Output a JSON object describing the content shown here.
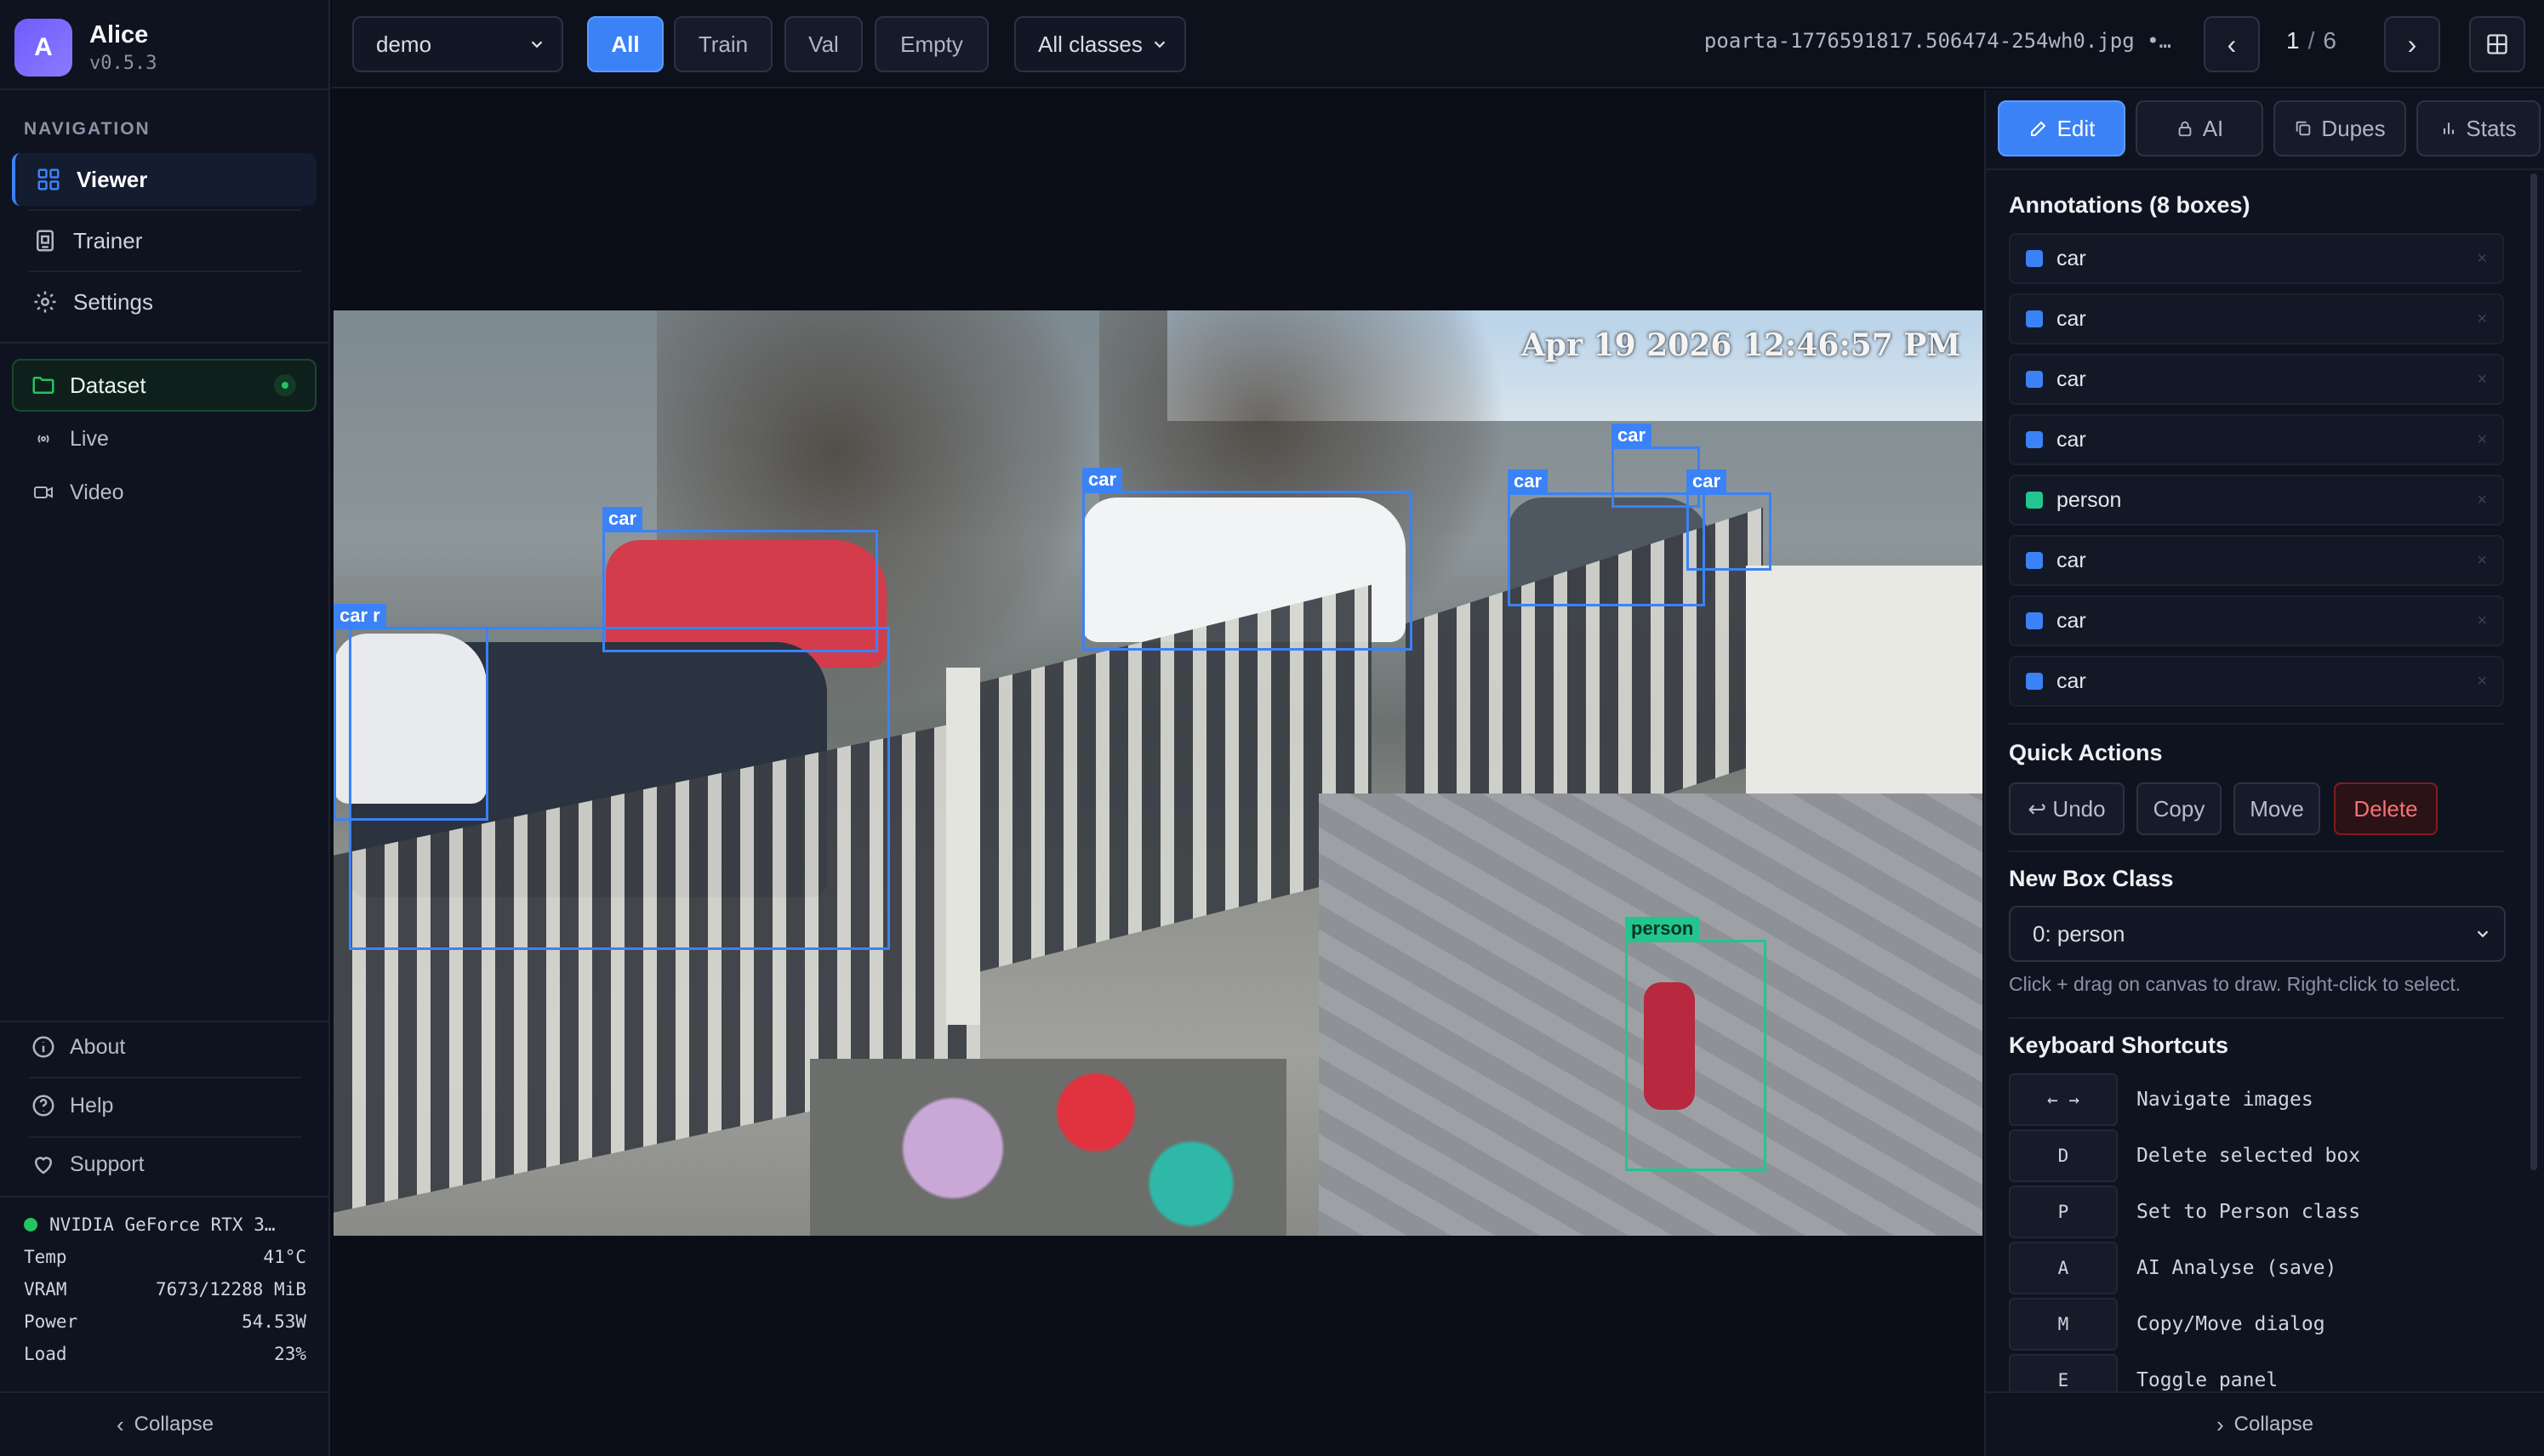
{
  "app": {
    "name": "Alice",
    "version": "v0.5.3",
    "avatar_letter": "A"
  },
  "sidebar": {
    "nav_heading": "NAVIGATION",
    "items": [
      {
        "label": "Viewer",
        "icon": "grid-icon",
        "active": true
      },
      {
        "label": "Trainer",
        "icon": "cpu-icon"
      },
      {
        "label": "Settings",
        "icon": "gear-icon"
      }
    ],
    "dataset": {
      "label": "Dataset",
      "icon": "folder-icon",
      "status": "online"
    },
    "sub_items": [
      {
        "label": "Live",
        "icon": "broadcast-icon"
      },
      {
        "label": "Video",
        "icon": "video-camera-icon"
      }
    ],
    "footer_items": [
      {
        "label": "About",
        "icon": "info-icon"
      },
      {
        "label": "Help",
        "icon": "help-circle-icon"
      },
      {
        "label": "Support",
        "icon": "heart-icon"
      }
    ],
    "gpu": {
      "name": "NVIDIA GeForce RTX 3…",
      "rows": [
        {
          "k": "Temp",
          "v": "41°C"
        },
        {
          "k": "VRAM",
          "v": "7673/12288 MiB"
        },
        {
          "k": "Power",
          "v": "54.53W"
        },
        {
          "k": "Load",
          "v": "23%"
        }
      ]
    },
    "collapse_label": "Collapse"
  },
  "topbar": {
    "dataset_select": "demo",
    "filters": [
      {
        "label": "All",
        "active": true
      },
      {
        "label": "Train"
      },
      {
        "label": "Val"
      },
      {
        "label": "Empty"
      }
    ],
    "class_select": "All classes",
    "filename": "poarta-1776591817.506474-254wh0.jpg •…",
    "page_current": "1",
    "page_sep": "/",
    "page_total": "6",
    "prev_icon": "chevron-left-icon",
    "next_icon": "chevron-right-icon",
    "layout_icon": "layout-grid-icon"
  },
  "image": {
    "camera_timestamp": "Apr 19 2026  12:46:57 PM",
    "boxes": [
      {
        "label": "car",
        "cls": "car"
      },
      {
        "label": "car r",
        "cls": "car"
      },
      {
        "label": "car",
        "cls": "car"
      },
      {
        "label": "car",
        "cls": "car"
      },
      {
        "label": "car",
        "cls": "car"
      },
      {
        "label": "car",
        "cls": "car"
      },
      {
        "label": "person",
        "cls": "person"
      }
    ]
  },
  "panel": {
    "tabs": [
      {
        "label": "Edit",
        "icon": "edit-icon",
        "active": true
      },
      {
        "label": "AI",
        "icon": "lock-icon"
      },
      {
        "label": "Dupes",
        "icon": "copy-icon"
      },
      {
        "label": "Stats",
        "icon": "bar-chart-icon"
      }
    ],
    "annotations_title": "Annotations (8 boxes)",
    "annotations": [
      {
        "label": "car",
        "color": "#3b82f6"
      },
      {
        "label": "car",
        "color": "#3b82f6"
      },
      {
        "label": "car",
        "color": "#3b82f6"
      },
      {
        "label": "car",
        "color": "#3b82f6"
      },
      {
        "label": "person",
        "color": "#22c58e"
      },
      {
        "label": "car",
        "color": "#3b82f6"
      },
      {
        "label": "car",
        "color": "#3b82f6"
      },
      {
        "label": "car",
        "color": "#3b82f6"
      }
    ],
    "delete_glyph": "×",
    "quick_actions_title": "Quick Actions",
    "quick_actions": {
      "undo": "↩ Undo",
      "copy": "Copy",
      "move": "Move",
      "delete": "Delete"
    },
    "new_box_title": "New Box Class",
    "new_box_value": "0: person",
    "hint": "Click + drag on canvas to draw. Right-click to select.",
    "shortcuts_title": "Keyboard Shortcuts",
    "shortcuts": [
      {
        "key": "← →",
        "desc": "Navigate images"
      },
      {
        "key": "D",
        "desc": "Delete selected box"
      },
      {
        "key": "P",
        "desc": "Set to Person class"
      },
      {
        "key": "A",
        "desc": "AI Analyse (save)"
      },
      {
        "key": "M",
        "desc": "Copy/Move dialog"
      },
      {
        "key": "E",
        "desc": "Toggle panel"
      }
    ],
    "collapse_label": "Collapse"
  },
  "colors": {
    "accent": "#3b82f6",
    "person": "#22c58e",
    "ok": "#22c55e",
    "danger": "#f87171"
  }
}
